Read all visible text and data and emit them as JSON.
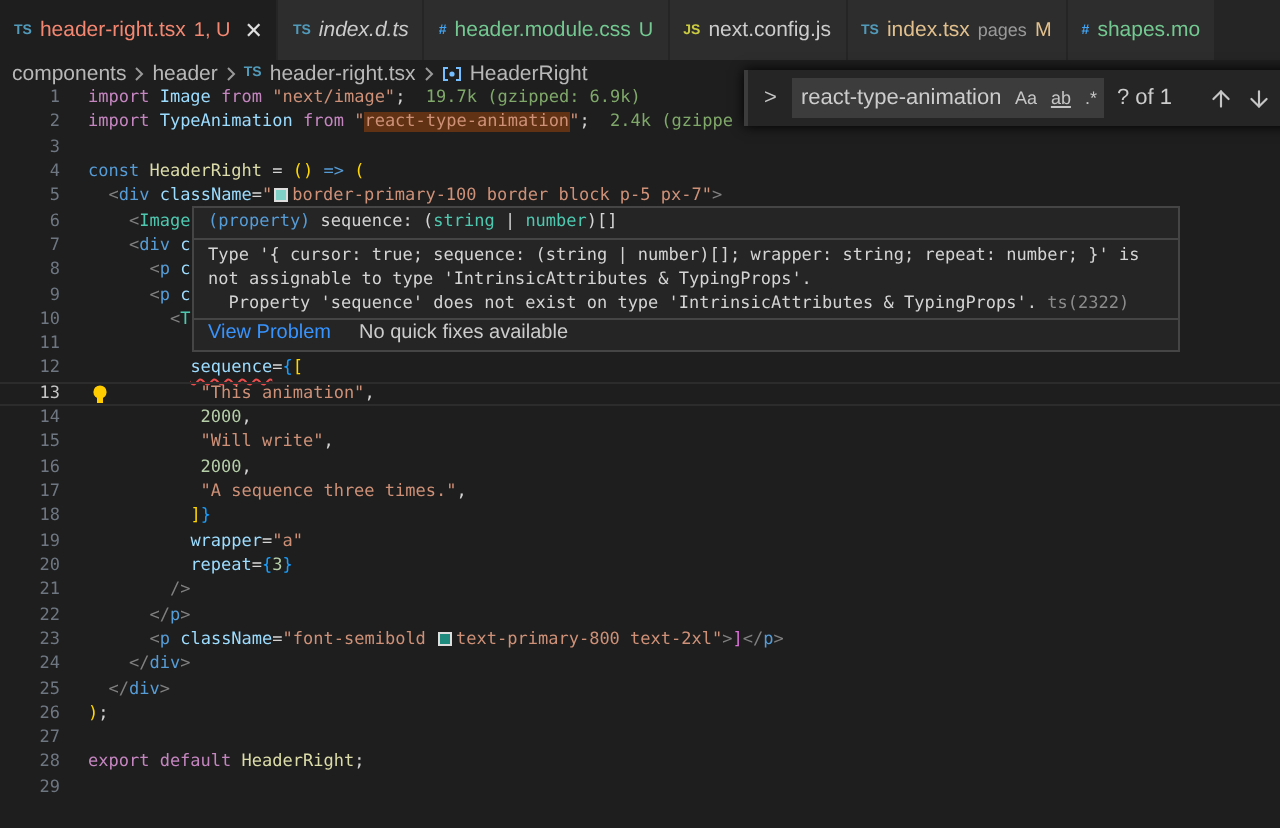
{
  "tabs": [
    {
      "icon": "TS",
      "kind": "ts",
      "label": "header-right.tsx",
      "decoration": "1, U",
      "color": "#f48771",
      "preview": false,
      "selected": true,
      "close": "✕"
    },
    {
      "icon": "TS",
      "kind": "ts",
      "label": "index.d.ts",
      "color": "#cccccc",
      "preview": true,
      "selected": false
    },
    {
      "icon": "#",
      "kind": "css",
      "label": "header.module.css",
      "decoration": "U",
      "color": "#73c991",
      "preview": false,
      "selected": false
    },
    {
      "icon": "JS",
      "kind": "js",
      "label": "next.config.js",
      "color": "#cccccc",
      "preview": false,
      "selected": false
    },
    {
      "icon": "TS",
      "kind": "ts",
      "label": "index.tsx",
      "detail": "pages",
      "decoration": "M",
      "color": "#e2c08d",
      "preview": false,
      "selected": false
    },
    {
      "icon": "#",
      "kind": "css",
      "label": "shapes.mo",
      "color": "#73c991",
      "preview": false,
      "selected": false
    }
  ],
  "breadcrumbs": [
    {
      "kind": "folder",
      "label": "components"
    },
    {
      "kind": "folder",
      "label": "header"
    },
    {
      "kind": "file",
      "icon": "TS",
      "label": "header-right.tsx"
    },
    {
      "kind": "symbol",
      "label": "HeaderRight"
    }
  ],
  "code_lines": [
    {
      "number": "1",
      "active": false,
      "tokens": [
        {
          "kind": "kw",
          "text": "import "
        },
        {
          "kind": "var",
          "text": "Image "
        },
        {
          "kind": "kw",
          "text": "from "
        },
        {
          "kind": "str",
          "text": "\"next/image\""
        },
        {
          "kind": "plain",
          "text": ";  "
        },
        {
          "kind": "hint",
          "text": "19.7k (gzipped: 6.9k)"
        }
      ]
    },
    {
      "number": "2",
      "active": false,
      "tokens": [
        {
          "kind": "kw",
          "text": "import "
        },
        {
          "kind": "var",
          "text": "TypeAnimation "
        },
        {
          "kind": "kw",
          "text": "from "
        },
        {
          "kind": "str",
          "text": "\""
        },
        {
          "kind": "match",
          "text": "react-type-animation"
        },
        {
          "kind": "str",
          "text": "\""
        },
        {
          "kind": "plain",
          "text": ";  "
        },
        {
          "kind": "hint",
          "text": "2.4k (gzippe"
        }
      ]
    },
    {
      "number": "3",
      "active": false
    },
    {
      "number": "4",
      "active": false,
      "tokens": [
        {
          "kind": "storage",
          "text": "const "
        },
        {
          "kind": "fn",
          "text": "HeaderRight "
        },
        {
          "kind": "plain",
          "text": "= "
        },
        {
          "kind": "bracket1",
          "text": "() "
        },
        {
          "kind": "storage",
          "text": "=> "
        },
        {
          "kind": "bracket1",
          "text": "("
        }
      ]
    },
    {
      "number": "5",
      "active": false,
      "tokens": [
        {
          "kind": "angle",
          "text": "  <"
        },
        {
          "kind": "tag",
          "text": "div "
        },
        {
          "kind": "attr",
          "text": "className"
        },
        {
          "kind": "plain",
          "text": "="
        },
        {
          "kind": "str",
          "text": "\""
        },
        {
          "kind": "swatch",
          "color": "#7fd1c8"
        },
        {
          "kind": "str",
          "text": "border-primary-100 border block p-5 px-7\""
        },
        {
          "kind": "angle",
          "text": ">"
        }
      ]
    },
    {
      "number": "6",
      "active": false,
      "tokens": [
        {
          "kind": "angle",
          "text": "    <"
        },
        {
          "kind": "comp",
          "text": "Image"
        }
      ]
    },
    {
      "number": "7",
      "active": false,
      "tokens": [
        {
          "kind": "angle",
          "text": "    <"
        },
        {
          "kind": "tag",
          "text": "div "
        },
        {
          "kind": "attr",
          "text": "c"
        }
      ]
    },
    {
      "number": "8",
      "active": false,
      "tokens": [
        {
          "kind": "angle",
          "text": "      <"
        },
        {
          "kind": "tag",
          "text": "p "
        },
        {
          "kind": "attr",
          "text": "c"
        }
      ]
    },
    {
      "number": "9",
      "active": false,
      "tokens": [
        {
          "kind": "angle",
          "text": "      <"
        },
        {
          "kind": "tag",
          "text": "p "
        },
        {
          "kind": "attr",
          "text": "c"
        }
      ]
    },
    {
      "number": "10",
      "active": false,
      "tokens": [
        {
          "kind": "angle",
          "text": "        <"
        },
        {
          "kind": "comp",
          "text": "T"
        }
      ]
    },
    {
      "number": "11",
      "active": false
    },
    {
      "number": "12",
      "active": false,
      "tokens": [
        {
          "kind": "error",
          "text": "          sequence"
        },
        {
          "kind": "plain",
          "text": "="
        },
        {
          "kind": "bracket2",
          "text": "{"
        },
        {
          "kind": "bracket1",
          "text": "["
        }
      ]
    },
    {
      "number": "13",
      "active": true,
      "lightbulb": true,
      "tokens": [
        {
          "kind": "str",
          "text": "           \"This animation\""
        },
        {
          "kind": "plain",
          "text": ","
        }
      ]
    },
    {
      "number": "14",
      "active": false,
      "tokens": [
        {
          "kind": "num",
          "text": "           2000"
        },
        {
          "kind": "plain",
          "text": ","
        }
      ]
    },
    {
      "number": "15",
      "active": false,
      "tokens": [
        {
          "kind": "str",
          "text": "           \"Will write\""
        },
        {
          "kind": "plain",
          "text": ","
        }
      ]
    },
    {
      "number": "16",
      "active": false,
      "tokens": [
        {
          "kind": "num",
          "text": "           2000"
        },
        {
          "kind": "plain",
          "text": ","
        }
      ]
    },
    {
      "number": "17",
      "active": false,
      "tokens": [
        {
          "kind": "str",
          "text": "           \"A sequence three times.\""
        },
        {
          "kind": "plain",
          "text": ","
        }
      ]
    },
    {
      "number": "18",
      "active": false,
      "tokens": [
        {
          "kind": "bracket1",
          "text": "          ]"
        },
        {
          "kind": "bracket2",
          "text": "}"
        }
      ]
    },
    {
      "number": "19",
      "active": false,
      "tokens": [
        {
          "kind": "attr",
          "text": "          wrapper"
        },
        {
          "kind": "plain",
          "text": "="
        },
        {
          "kind": "str",
          "text": "\"a\""
        }
      ]
    },
    {
      "number": "20",
      "active": false,
      "tokens": [
        {
          "kind": "attr",
          "text": "          repeat"
        },
        {
          "kind": "plain",
          "text": "="
        },
        {
          "kind": "bracket2",
          "text": "{"
        },
        {
          "kind": "num",
          "text": "3"
        },
        {
          "kind": "bracket2",
          "text": "}"
        }
      ]
    },
    {
      "number": "21",
      "active": false,
      "tokens": [
        {
          "kind": "angle",
          "text": "        />"
        }
      ]
    },
    {
      "number": "22",
      "active": false,
      "tokens": [
        {
          "kind": "angle",
          "text": "      </"
        },
        {
          "kind": "tag",
          "text": "p"
        },
        {
          "kind": "angle",
          "text": ">"
        }
      ]
    },
    {
      "number": "23",
      "active": false,
      "tokens": [
        {
          "kind": "angle",
          "text": "      <"
        },
        {
          "kind": "tag",
          "text": "p "
        },
        {
          "kind": "attr",
          "text": "className"
        },
        {
          "kind": "plain",
          "text": "="
        },
        {
          "kind": "str",
          "text": "\"font-semibold "
        },
        {
          "kind": "swatch",
          "color": "#1f8a7e"
        },
        {
          "kind": "str",
          "text": "text-primary-800 text-2xl\""
        },
        {
          "kind": "angle",
          "text": ">"
        },
        {
          "kind": "bracket3",
          "text": "]"
        },
        {
          "kind": "angle",
          "text": "</"
        },
        {
          "kind": "tag",
          "text": "p"
        },
        {
          "kind": "angle",
          "text": ">"
        }
      ]
    },
    {
      "number": "24",
      "active": false,
      "tokens": [
        {
          "kind": "angle",
          "text": "    </"
        },
        {
          "kind": "tag",
          "text": "div"
        },
        {
          "kind": "angle",
          "text": ">"
        }
      ]
    },
    {
      "number": "25",
      "active": false,
      "tokens": [
        {
          "kind": "angle",
          "text": "  </"
        },
        {
          "kind": "tag",
          "text": "div"
        },
        {
          "kind": "angle",
          "text": ">"
        }
      ]
    },
    {
      "number": "26",
      "active": false,
      "tokens": [
        {
          "kind": "bracket1",
          "text": ")"
        },
        {
          "kind": "plain",
          "text": ";"
        }
      ]
    },
    {
      "number": "27",
      "active": false
    },
    {
      "number": "28",
      "active": false,
      "tokens": [
        {
          "kind": "kw",
          "text": "export default "
        },
        {
          "kind": "fn",
          "text": "HeaderRight"
        },
        {
          "kind": "plain",
          "text": ";"
        }
      ]
    },
    {
      "number": "29",
      "active": false
    }
  ],
  "hover": {
    "signature": [
      {
        "kind": "storage",
        "text": "(property)"
      },
      {
        "kind": "plain",
        "text": " sequence: ("
      },
      {
        "kind": "type",
        "text": "string"
      },
      {
        "kind": "plain",
        "text": " | "
      },
      {
        "kind": "type",
        "text": "number"
      },
      {
        "kind": "plain",
        "text": ")[]"
      }
    ],
    "message": [
      "Type '{ cursor: true; sequence: (string | number)[]; wrapper: string; repeat: number; }' is",
      "not assignable to type 'IntrinsicAttributes & TypingProps'.",
      "  Property 'sequence' does not exist on type 'IntrinsicAttributes & TypingProps'."
    ],
    "code": "ts(2322)",
    "link": "View Problem",
    "note": "No quick fixes available"
  },
  "find": {
    "toggle": ">",
    "value": "react-type-animation",
    "options": [
      {
        "label": "Aa",
        "on": false
      },
      {
        "label": "ab",
        "on": false
      },
      {
        "label": ".*",
        "on": false
      }
    ],
    "count": "? of 1"
  }
}
